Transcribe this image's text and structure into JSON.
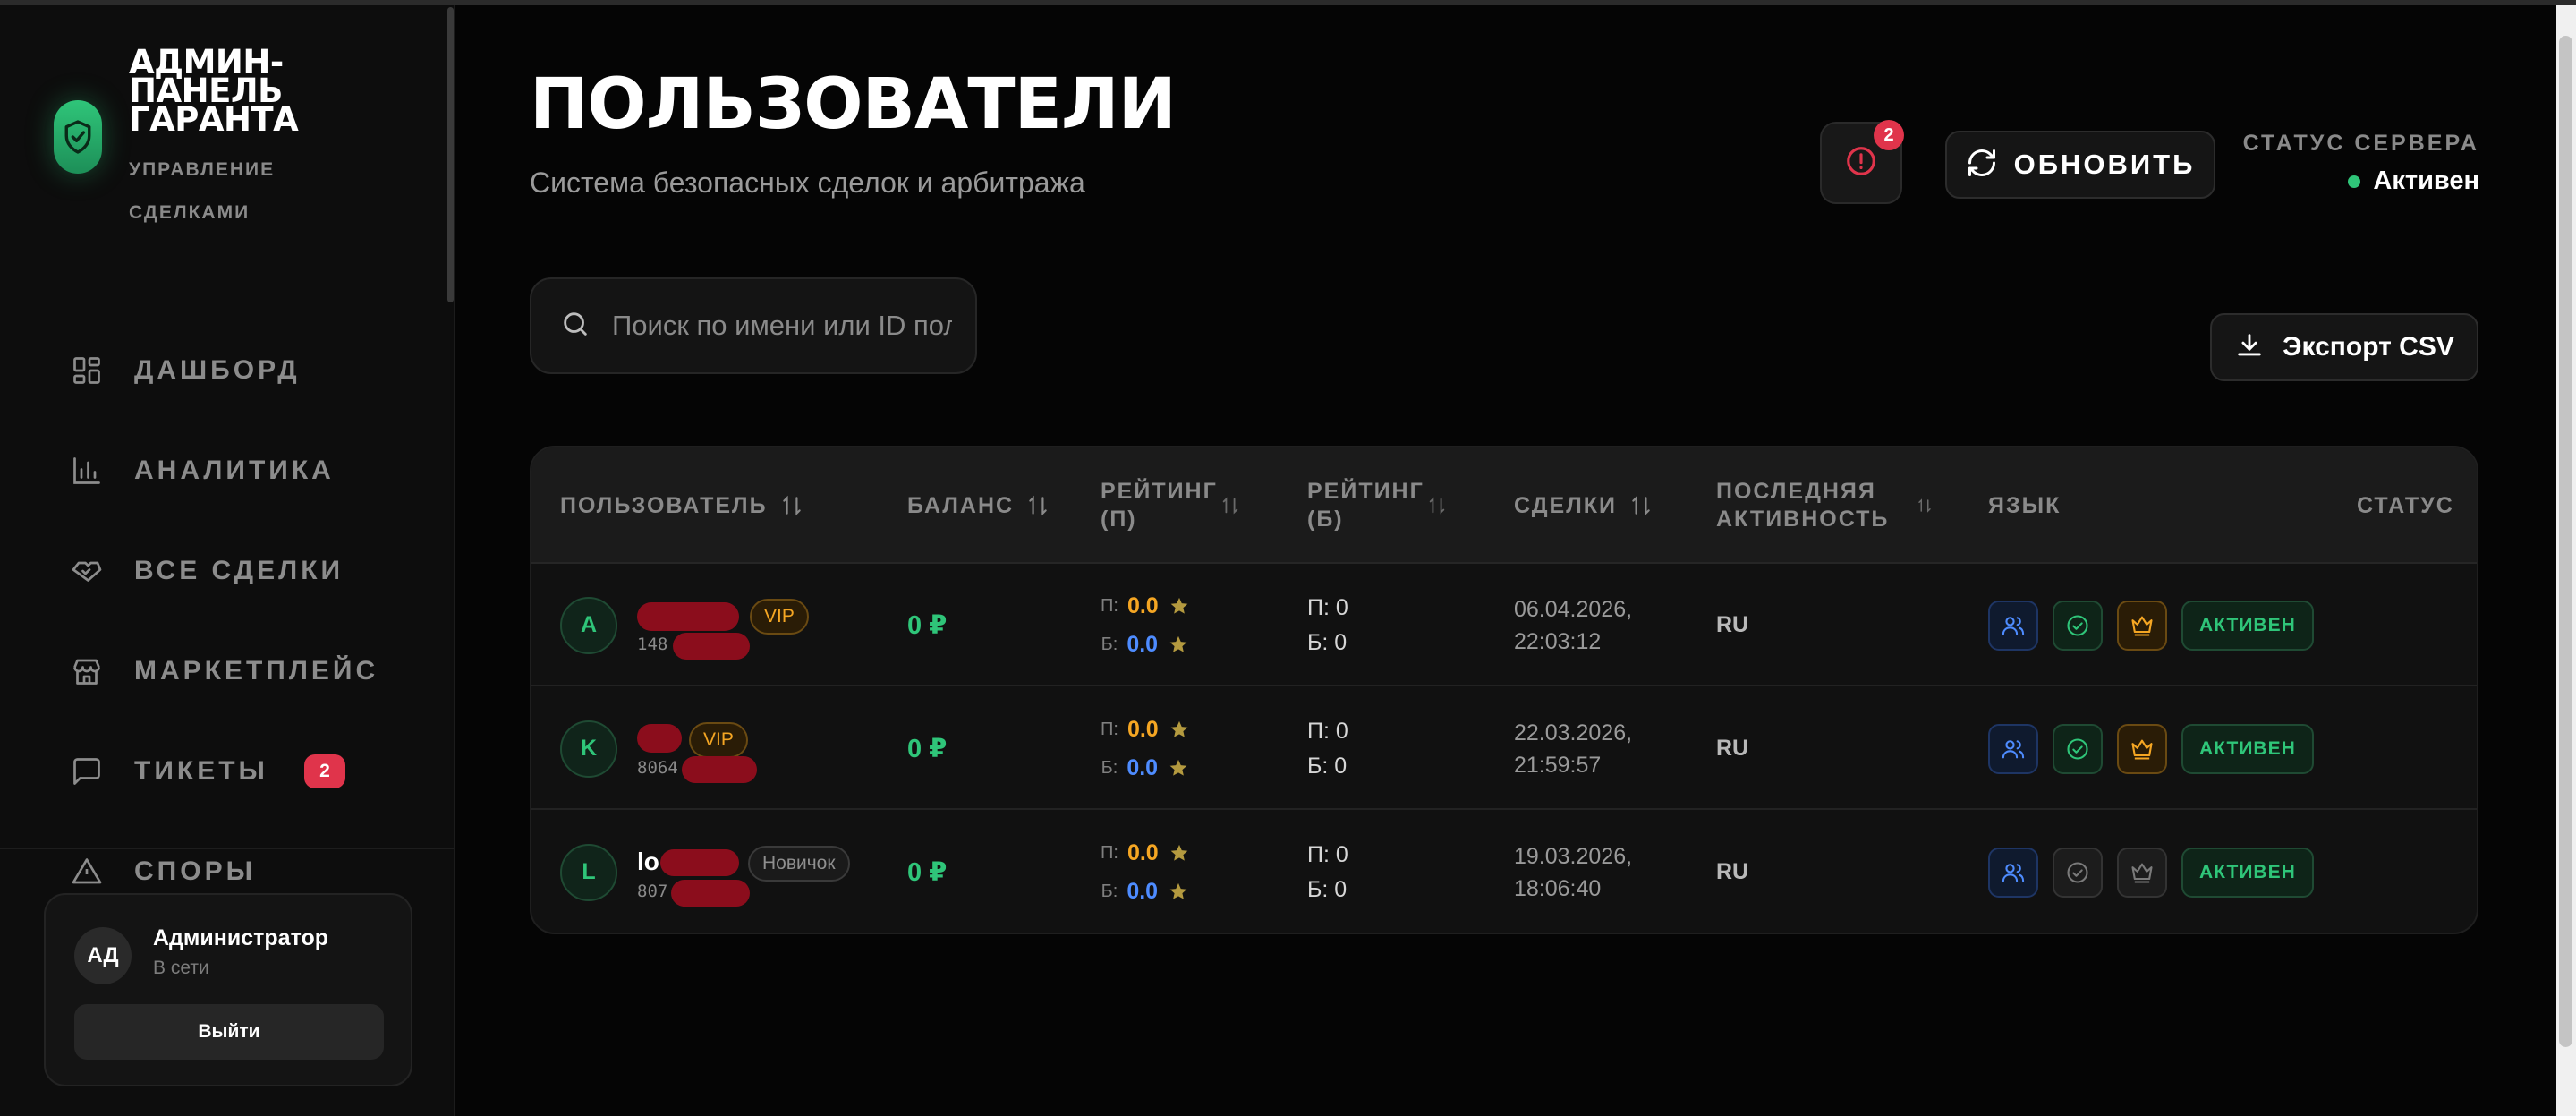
{
  "brand": {
    "title": "АДМИН-ПАНЕЛЬ ГАРАНТА",
    "subtitle": "УПРАВЛЕНИЕ СДЕЛКАМИ"
  },
  "nav": {
    "items": [
      {
        "label": "ДАШБОРД",
        "icon": "dashboard-icon"
      },
      {
        "label": "АНАЛИТИКА",
        "icon": "bar-chart-icon"
      },
      {
        "label": "ВСЕ СДЕЛКИ",
        "icon": "handshake-icon"
      },
      {
        "label": "МАРКЕТПЛЕЙС",
        "icon": "store-icon"
      },
      {
        "label": "ТИКЕТЫ",
        "icon": "message-icon",
        "badge": "2"
      },
      {
        "label": "СПОРЫ",
        "icon": "alert-triangle-icon"
      }
    ]
  },
  "admin": {
    "initials": "АД",
    "name": "Администратор",
    "status": "В сети",
    "logout_label": "Выйти"
  },
  "header": {
    "title": "ПОЛЬЗОВАТЕЛИ",
    "subtitle": "Система безопасных сделок и арбитража",
    "alerts_badge": "2",
    "refresh_label": "ОБНОВИТЬ",
    "server_label": "СТАТУС СЕРВЕРА",
    "server_status": "Активен"
  },
  "search": {
    "placeholder": "Поиск по имени или ID пол",
    "value": ""
  },
  "export_label": "Экспорт CSV",
  "table": {
    "columns": {
      "user": "ПОЛЬЗОВАТЕЛЬ",
      "balance": "БАЛАНС",
      "rating_p": "РЕЙТИНГ (П)",
      "rating_b": "РЕЙТИНГ (Б)",
      "deals": "СДЕЛКИ",
      "last_activity": "ПОСЛЕДНЯЯ АКТИВНОСТЬ",
      "language": "ЯЗЫК",
      "status": "СТАТУС"
    },
    "rows": [
      {
        "initial": "A",
        "name": "",
        "id": "148",
        "tag": "VIP",
        "balance": "0 ₽",
        "rating_p_label": "П:",
        "rating_p": "0.0",
        "rating_b_label": "Б:",
        "rating_b": "0.0",
        "deals_p": "П: 0",
        "deals_b": "Б: 0",
        "last_activity": "06.04.2026, 22:03:12",
        "language": "RU",
        "status": "АКТИВЕН",
        "verified": true,
        "vip_active": true
      },
      {
        "initial": "K",
        "name": "",
        "id": "8064",
        "tag": "VIP",
        "balance": "0 ₽",
        "rating_p_label": "П:",
        "rating_p": "0.0",
        "rating_b_label": "Б:",
        "rating_b": "0.0",
        "deals_p": "П: 0",
        "deals_b": "Б: 0",
        "last_activity": "22.03.2026, 21:59:57",
        "language": "RU",
        "status": "АКТИВЕН",
        "verified": true,
        "vip_active": true
      },
      {
        "initial": "L",
        "name": "lo",
        "id": "807",
        "tag": "Новичок",
        "balance": "0 ₽",
        "rating_p_label": "П:",
        "rating_p": "0.0",
        "rating_b_label": "Б:",
        "rating_b": "0.0",
        "deals_p": "П: 0",
        "deals_b": "Б: 0",
        "last_activity": "19.03.2026, 18:06:40",
        "language": "RU",
        "status": "АКТИВЕН",
        "verified": false,
        "vip_active": false
      }
    ]
  },
  "colors": {
    "accent_green": "#2fc579",
    "accent_orange": "#f5a623",
    "accent_blue": "#4e8cff",
    "badge_red": "#e0344b"
  }
}
